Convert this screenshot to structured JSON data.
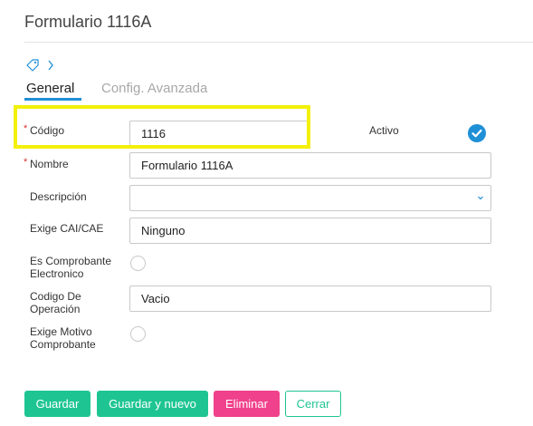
{
  "page": {
    "title": "Formulario 1116A"
  },
  "tabs": [
    {
      "label": "General",
      "active": true
    },
    {
      "label": "Config. Avanzada",
      "active": false
    }
  ],
  "icons": {
    "tag": "tag-icon",
    "chevron": "chevron-right-icon",
    "check": "check-circle-icon",
    "caret": "chevron-down-icon"
  },
  "form": {
    "required_mark": "*",
    "codigo": {
      "label": "Código",
      "value": "1116"
    },
    "activo": {
      "label": "Activo",
      "checked": true
    },
    "nombre": {
      "label": "Nombre",
      "value": "Formulario 1116A"
    },
    "descripcion": {
      "label": "Descripción",
      "value": ""
    },
    "exige_cai": {
      "label": "Exige CAI/CAE",
      "value": "Ninguno"
    },
    "es_comprobante": {
      "label_line1": "Es Comprobante",
      "label_line2": "Electronico",
      "checked": false
    },
    "codigo_operacion": {
      "label_line1": "Codigo De",
      "label_line2": "Operación",
      "value": "Vacio"
    },
    "exige_motivo": {
      "label_line1": "Exige Motivo",
      "label_line2": "Comprobante",
      "checked": false
    }
  },
  "buttons": {
    "save": "Guardar",
    "save_new": "Guardar y nuevo",
    "delete": "Eliminar",
    "close": "Cerrar"
  },
  "colors": {
    "accent": "#1f8fd6",
    "success": "#1ec592",
    "danger": "#f0418c",
    "highlight": "#f3f00a",
    "required": "#e0302f"
  }
}
